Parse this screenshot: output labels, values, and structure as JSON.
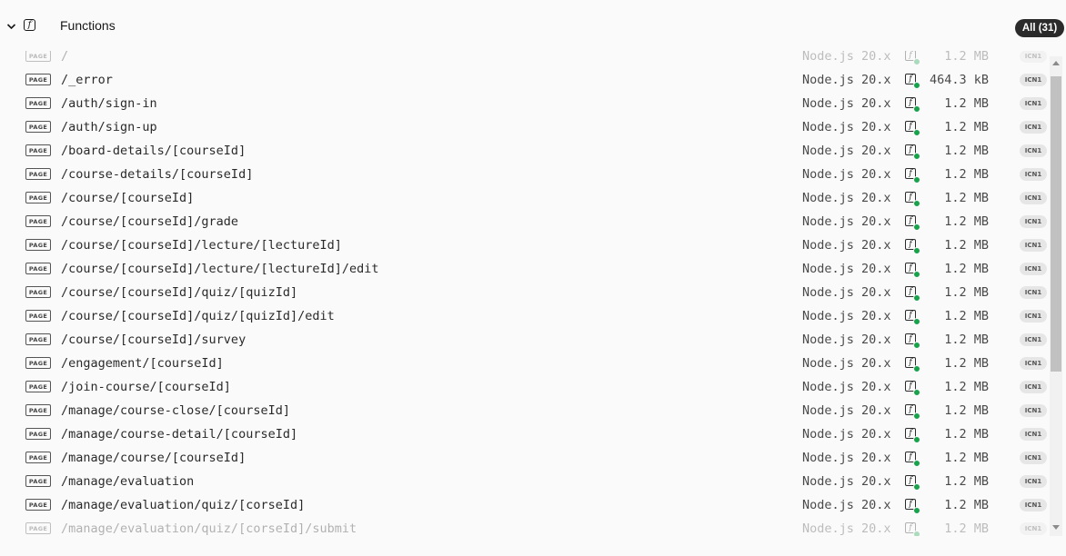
{
  "header": {
    "title": "Functions",
    "all_badge": "All (31)",
    "chevron_icon": "chevron-down-icon",
    "function_icon": "function-icon",
    "function_glyph": "f"
  },
  "row_page_tag": "PAGE",
  "rows": [
    {
      "route": "/",
      "runtime": "Node.js 20.x",
      "size": "1.2 MB",
      "region": "ICN1"
    },
    {
      "route": "/_error",
      "runtime": "Node.js 20.x",
      "size": "464.3 kB",
      "region": "ICN1"
    },
    {
      "route": "/auth/sign-in",
      "runtime": "Node.js 20.x",
      "size": "1.2 MB",
      "region": "ICN1"
    },
    {
      "route": "/auth/sign-up",
      "runtime": "Node.js 20.x",
      "size": "1.2 MB",
      "region": "ICN1"
    },
    {
      "route": "/board-details/[courseId]",
      "runtime": "Node.js 20.x",
      "size": "1.2 MB",
      "region": "ICN1"
    },
    {
      "route": "/course-details/[courseId]",
      "runtime": "Node.js 20.x",
      "size": "1.2 MB",
      "region": "ICN1"
    },
    {
      "route": "/course/[courseId]",
      "runtime": "Node.js 20.x",
      "size": "1.2 MB",
      "region": "ICN1"
    },
    {
      "route": "/course/[courseId]/grade",
      "runtime": "Node.js 20.x",
      "size": "1.2 MB",
      "region": "ICN1"
    },
    {
      "route": "/course/[courseId]/lecture/[lectureId]",
      "runtime": "Node.js 20.x",
      "size": "1.2 MB",
      "region": "ICN1"
    },
    {
      "route": "/course/[courseId]/lecture/[lectureId]/edit",
      "runtime": "Node.js 20.x",
      "size": "1.2 MB",
      "region": "ICN1"
    },
    {
      "route": "/course/[courseId]/quiz/[quizId]",
      "runtime": "Node.js 20.x",
      "size": "1.2 MB",
      "region": "ICN1"
    },
    {
      "route": "/course/[courseId]/quiz/[quizId]/edit",
      "runtime": "Node.js 20.x",
      "size": "1.2 MB",
      "region": "ICN1"
    },
    {
      "route": "/course/[courseId]/survey",
      "runtime": "Node.js 20.x",
      "size": "1.2 MB",
      "region": "ICN1"
    },
    {
      "route": "/engagement/[courseId]",
      "runtime": "Node.js 20.x",
      "size": "1.2 MB",
      "region": "ICN1"
    },
    {
      "route": "/join-course/[courseId]",
      "runtime": "Node.js 20.x",
      "size": "1.2 MB",
      "region": "ICN1"
    },
    {
      "route": "/manage/course-close/[courseId]",
      "runtime": "Node.js 20.x",
      "size": "1.2 MB",
      "region": "ICN1"
    },
    {
      "route": "/manage/course-detail/[courseId]",
      "runtime": "Node.js 20.x",
      "size": "1.2 MB",
      "region": "ICN1"
    },
    {
      "route": "/manage/course/[courseId]",
      "runtime": "Node.js 20.x",
      "size": "1.2 MB",
      "region": "ICN1"
    },
    {
      "route": "/manage/evaluation",
      "runtime": "Node.js 20.x",
      "size": "1.2 MB",
      "region": "ICN1"
    },
    {
      "route": "/manage/evaluation/quiz/[corseId]",
      "runtime": "Node.js 20.x",
      "size": "1.2 MB",
      "region": "ICN1"
    },
    {
      "route": "/manage/evaluation/quiz/[corseId]/submit",
      "runtime": "Node.js 20.x",
      "size": "1.2 MB",
      "region": "ICN1"
    }
  ],
  "colors": {
    "background": "#fafafa",
    "badge_bg": "#2b2b2b",
    "status_green": "#16a34a",
    "region_bg": "#e6e6e6"
  }
}
